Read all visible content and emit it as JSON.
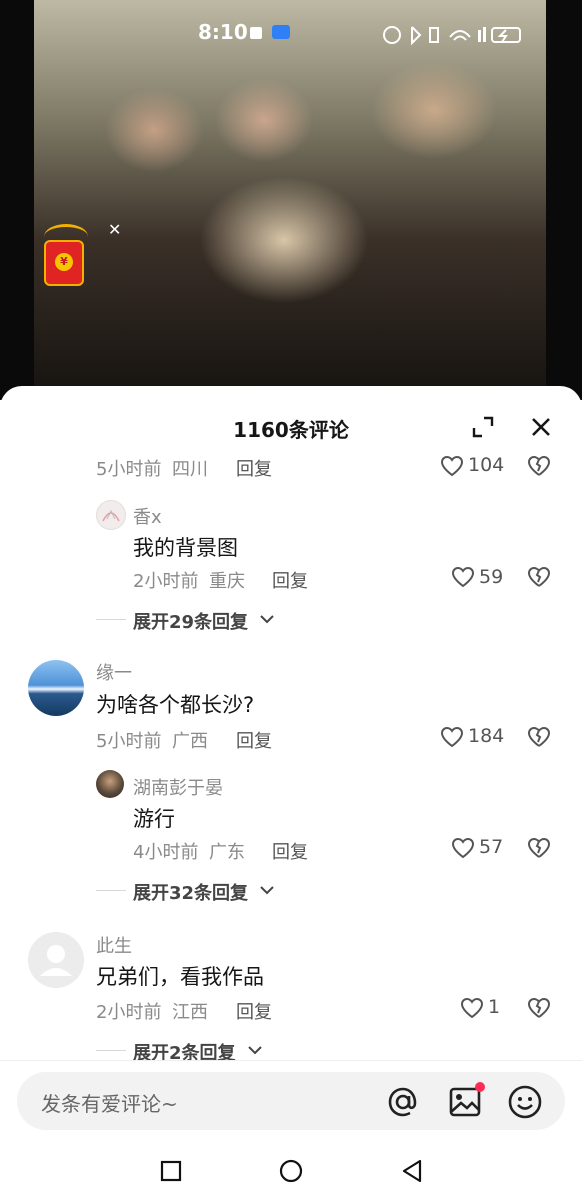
{
  "status_bar": {
    "time": "8:10"
  },
  "comments_panel": {
    "title": "1160条评论"
  },
  "comments": [
    {
      "id": "c0",
      "meta_time": "5小时前",
      "meta_region": "四川",
      "reply_label": "回复",
      "likes": "104"
    },
    {
      "id": "r0",
      "user": "香x",
      "text": "我的背景图",
      "meta_time": "2小时前",
      "meta_region": "重庆",
      "reply_label": "回复",
      "likes": "59",
      "expand_label": "展开29条回复"
    },
    {
      "id": "c1",
      "user": "缘一",
      "text": "为啥各个都长沙?",
      "meta_time": "5小时前",
      "meta_region": "广西",
      "reply_label": "回复",
      "likes": "184"
    },
    {
      "id": "r1",
      "user": "湖南彭于晏",
      "text": "游行",
      "meta_time": "4小时前",
      "meta_region": "广东",
      "reply_label": "回复",
      "likes": "57",
      "expand_label": "展开32条回复"
    },
    {
      "id": "c2",
      "user": "此生",
      "text": "兄弟们，看我作品",
      "meta_time": "2小时前",
      "meta_region": "江西",
      "reply_label": "回复",
      "likes": "1",
      "expand_label": "展开2条回复"
    }
  ],
  "input": {
    "placeholder": "发条有爱评论~"
  },
  "colors": {
    "accent_dot": "#ff2c55",
    "red_packet": "#e02323"
  },
  "icons": [
    "expand-icon",
    "close-icon",
    "heart-icon",
    "dislike-icon",
    "at-icon",
    "image-icon",
    "emoji-icon",
    "square-nav-icon",
    "circle-nav-icon",
    "back-nav-icon"
  ]
}
